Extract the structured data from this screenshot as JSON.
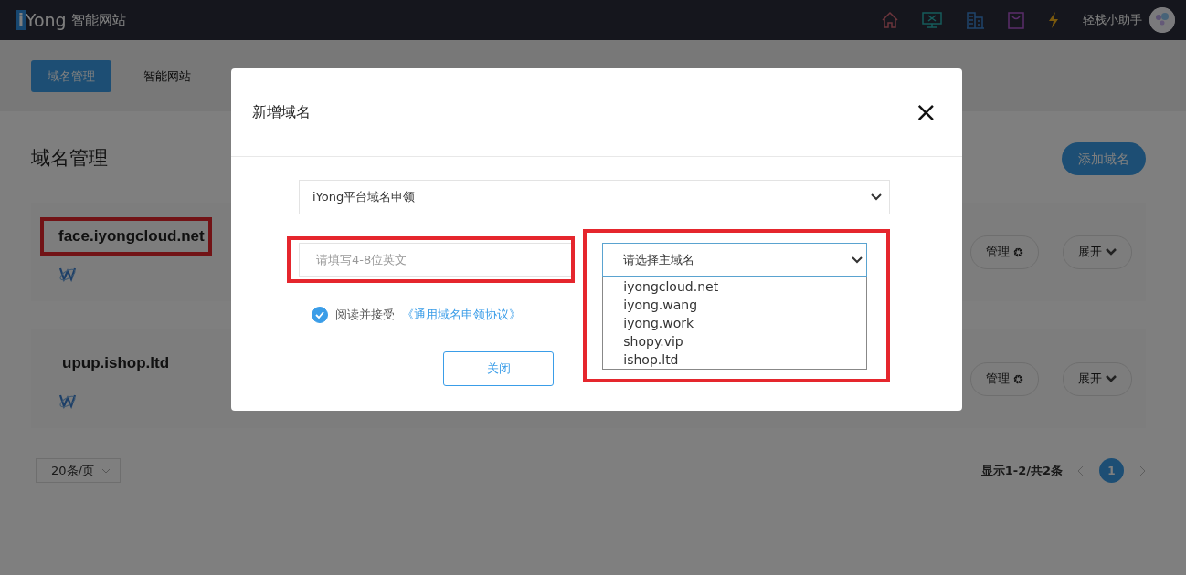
{
  "navbar": {
    "logo_letter": "i",
    "logo_text": "Yong",
    "site_name": "智能网站",
    "user_name": "轻栈小助手"
  },
  "tabs": [
    {
      "label": "域名管理",
      "selected": true
    },
    {
      "label": "智能网站",
      "selected": false
    }
  ],
  "page_title": "域名管理",
  "add_button": "添加域名",
  "domains": [
    {
      "name": "face.iyongcloud.net",
      "highlighted": true,
      "manage": "管理",
      "expand": "展开"
    },
    {
      "name": "upup.ishop.ltd",
      "highlighted": false,
      "manage": "管理",
      "expand": "展开"
    }
  ],
  "pagination": {
    "page_size": "20条/页",
    "summary": "显示1-2/共2条",
    "pages": [
      {
        "label": "1",
        "selected": true
      }
    ]
  },
  "modal": {
    "title": "新增域名",
    "close": "×",
    "type_select": {
      "value": "iYong平台域名申领"
    },
    "subdomain_field": {
      "placeholder": "请填写4-8位英文",
      "highlighted": true
    },
    "main_domain_select": {
      "placeholder": "请选择主域名",
      "highlighted": true,
      "expanded": true,
      "options": [
        "iyongcloud.net",
        "iyong.wang",
        "iyong.work",
        "shopy.vip",
        "ishop.ltd"
      ]
    },
    "agreement": {
      "checked": true,
      "text": "阅读并接受",
      "link": "《通用域名申领协议》"
    },
    "buttons": [
      "关闭"
    ]
  }
}
